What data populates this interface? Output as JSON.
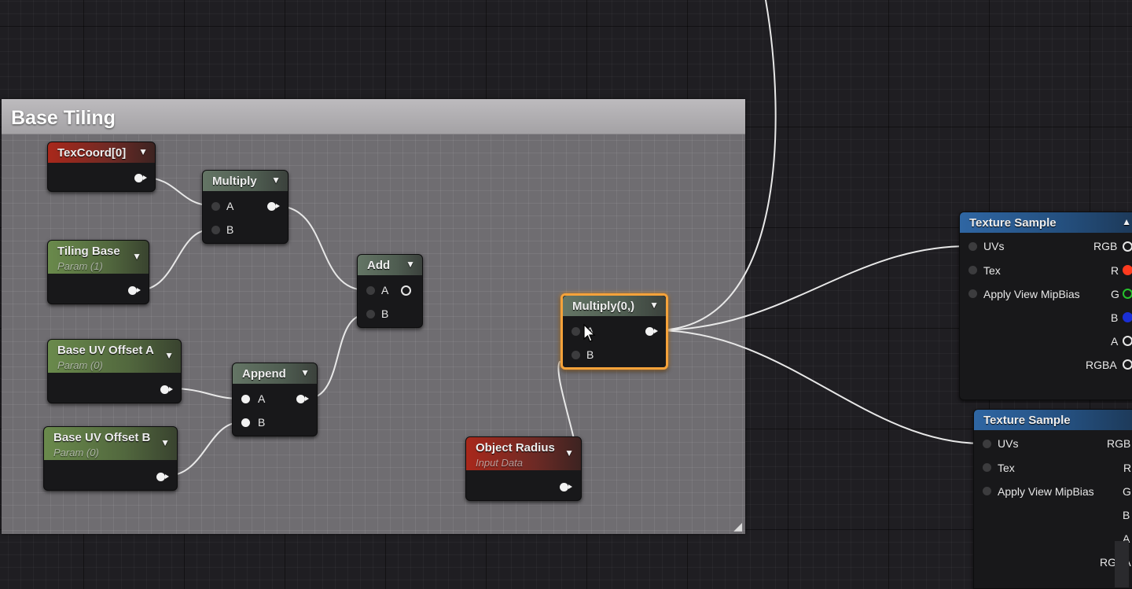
{
  "comment": {
    "title": "Base Tiling"
  },
  "nodes": {
    "texcoord": {
      "title": "TexCoord[0]"
    },
    "tiling_base": {
      "title": "Tiling Base",
      "subtitle": "Param (1)"
    },
    "multiply": {
      "title": "Multiply",
      "inputs": [
        "A",
        "B"
      ]
    },
    "add": {
      "title": "Add",
      "inputs": [
        "A",
        "B"
      ]
    },
    "offset_a": {
      "title": "Base UV Offset A",
      "subtitle": "Param (0)"
    },
    "offset_b": {
      "title": "Base UV Offset B",
      "subtitle": "Param (0)"
    },
    "append": {
      "title": "Append",
      "inputs": [
        "A",
        "B"
      ]
    },
    "multiply_sel": {
      "title": "Multiply(0,)",
      "inputs": [
        "A",
        "B"
      ]
    },
    "object_radius": {
      "title": "Object Radius",
      "subtitle": "Input Data"
    },
    "texture_sample_1": {
      "title": "Texture Sample",
      "inputs": [
        "UVs",
        "Tex",
        "Apply View MipBias"
      ],
      "outputs": [
        "RGB",
        "R",
        "G",
        "B",
        "A",
        "RGBA"
      ]
    },
    "texture_sample_2": {
      "title": "Texture Sample",
      "inputs": [
        "UVs",
        "Tex",
        "Apply View MipBias"
      ],
      "outputs": [
        "RGB",
        "R",
        "G",
        "B",
        "A",
        "RGBA"
      ]
    }
  },
  "pin_colors": {
    "R": "#ff3b1f",
    "G": "#27c22d",
    "B": "#1a2fd6"
  },
  "colors": {
    "selection": "#f5a23a",
    "wire": "#e8e8e8"
  }
}
